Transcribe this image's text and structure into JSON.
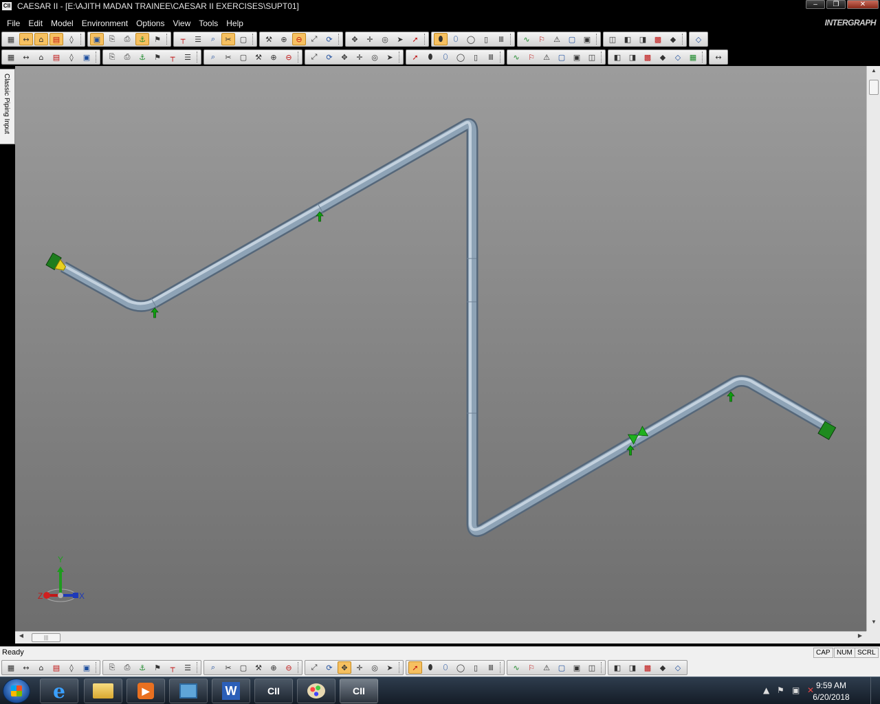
{
  "titlebar": {
    "app_icon_text": "CII",
    "title": "CAESAR II - [E:\\AJITH MADAN TRAINEE\\CAESAR II EXERCISES\\SUPT01]",
    "min_icon": "minimize-icon",
    "max_icon": "restore-icon",
    "close_icon": "close-icon"
  },
  "menu": {
    "items": [
      "File",
      "Edit",
      "Model",
      "Environment",
      "Options",
      "View",
      "Tools",
      "Help"
    ],
    "brand": "INTERGRAPH"
  },
  "toolbars": {
    "row1_icons": [
      "grid-icon",
      "dimension-icon",
      "plane-icon",
      "report-icon",
      "node-icon",
      "display-icon",
      "copy-icon",
      "print-icon",
      "restraint-icon",
      "hanger-icon",
      "tee-icon",
      "list-icon",
      "binoculars-icon",
      "cut-icon",
      "box-icon",
      "hammer-icon",
      "zoom-window-icon",
      "zoom-icon",
      "zoom-fit-icon",
      "rotate-icon",
      "pan-icon",
      "move-icon",
      "orbit-icon",
      "select-icon",
      "select-plus-icon",
      "cylinder-icon",
      "cylinder2-icon",
      "cylinder3-icon",
      "cylinder4-icon",
      "cylinder5-icon",
      "bars-icon",
      "wave-icon",
      "flag-icon",
      "warning-icon",
      "cube1-icon",
      "cube2-icon",
      "cube3-icon",
      "cube4-icon",
      "cube5-icon",
      "cube6-icon",
      "diamond-icon"
    ],
    "row2_icons": [
      "new-icon",
      "open-icon",
      "save-icon",
      "cut-icon",
      "copy-icon",
      "paste-icon",
      "print-icon",
      "list-icon",
      "pdf-icon",
      "tower-icon",
      "valve-icon",
      "nozzle-icon",
      "grid2-icon",
      "stack-icon",
      "edit-icon",
      "card-icon",
      "pipe-icon",
      "flange-icon",
      "reducer-icon",
      "bend-icon",
      "expansion-icon",
      "thermometer-icon",
      "pressure-icon",
      "fire-icon",
      "link-icon",
      "pump-icon",
      "load-icon",
      "restraint2-icon",
      "anchor-icon",
      "guide-icon",
      "spring-icon",
      "doc-icon",
      "report2-icon",
      "swap-icon",
      "globe-icon",
      "calc-icon",
      "spark-icon",
      "table-icon",
      "matrix-icon",
      "note-icon",
      "red-box-icon",
      "tee-red-icon",
      "curve-icon"
    ],
    "bottom_icons": [
      "list3-icon",
      "cal-icon",
      "triangle-icon",
      "hanger-box-icon",
      "sigma-icon",
      "panel-icon",
      "e-icon",
      "rho-icon",
      "chart-icon",
      "brush-icon",
      "brush2-icon",
      "brush3-icon",
      "ai-icon",
      "select-box-icon",
      "view2-icon",
      "frame-icon",
      "grid3-icon",
      "arrow-icon",
      "bridge-icon",
      "hat-icon",
      "doc3-icon",
      "tee3-icon",
      "angle-icon",
      "support-icon",
      "cap-icon",
      "spring-icon",
      "valve3-icon",
      "d-icon",
      "load3-icon",
      "node3-icon",
      "chain-icon",
      "prev-icon",
      "back-icon",
      "forward-icon",
      "next-icon",
      "beam-icon",
      "gate-icon",
      "spark2-icon",
      "refresh-icon",
      "lock-icon",
      "pen-icon"
    ]
  },
  "sidetab": {
    "label": "Classic Piping Input"
  },
  "viewport": {
    "axis_labels": {
      "y": "Y",
      "x": "X",
      "z": "Z"
    }
  },
  "statusbar": {
    "status": "Ready",
    "indicators": [
      "CAP",
      "NUM",
      "SCRL"
    ]
  },
  "taskbar": {
    "apps": [
      {
        "name": "ie",
        "label": "e"
      },
      {
        "name": "explorer",
        "label": ""
      },
      {
        "name": "media",
        "label": ""
      },
      {
        "name": "network",
        "label": ""
      },
      {
        "name": "word",
        "label": "W"
      },
      {
        "name": "caesar1",
        "label": "CII"
      },
      {
        "name": "paint",
        "label": ""
      },
      {
        "name": "caesar2",
        "label": "CII"
      }
    ],
    "time": "9:59 AM",
    "date": "6/20/2018"
  },
  "colors": {
    "pipe": "#9fb4c6",
    "pipe_shadow": "#5f7284",
    "anchor": "#1e7d1e",
    "restraint": "#0fa00f",
    "hanger": "#e8d020",
    "background_top": "#9c9c9c",
    "background_bottom": "#6e6e6e"
  }
}
